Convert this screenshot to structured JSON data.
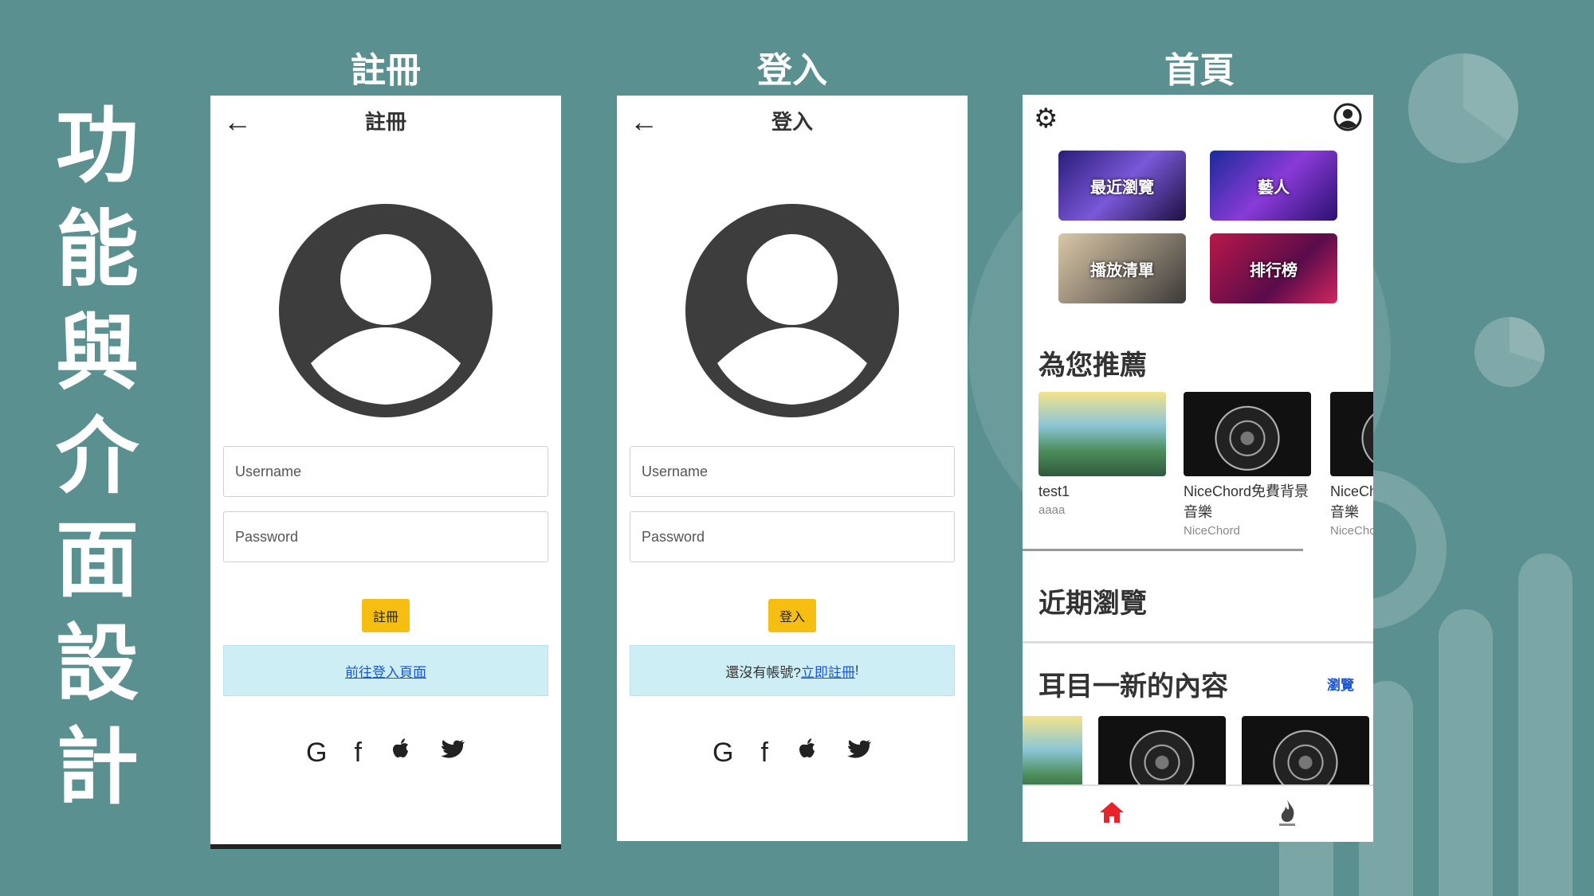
{
  "side_title": [
    "功",
    "能",
    "與",
    "介",
    "面",
    "設",
    "計"
  ],
  "panels": {
    "register": {
      "title": "註冊",
      "header": "註冊",
      "username_placeholder": "Username",
      "password_placeholder": "Password",
      "button": "註冊",
      "link": "前往登入頁面"
    },
    "login": {
      "title": "登入",
      "header": "登入",
      "username_placeholder": "Username",
      "password_placeholder": "Password",
      "button": "登入",
      "prompt": "還沒有帳號? ",
      "link": "立即註冊",
      "suffix": "!"
    },
    "home": {
      "title": "首頁",
      "categories": [
        "最近瀏覽",
        "藝人",
        "播放清單",
        "排行榜"
      ],
      "recommend_title": "為您推薦",
      "recommendations": [
        {
          "title": "test1",
          "subtitle": "aaaa"
        },
        {
          "title": "NiceChord免費背景音樂",
          "subtitle": "NiceChord"
        },
        {
          "title": "NiceCh 音樂",
          "subtitle": "NiceCho"
        }
      ],
      "recent_title": "近期瀏覽",
      "new_title": "耳目一新的內容",
      "browse_link": "瀏覽"
    }
  },
  "icons": {
    "back": "←",
    "social": [
      "G",
      "f",
      "",
      "🐦"
    ],
    "gear": "⚙",
    "account": "◉",
    "home": "⌂",
    "fire": "🔥"
  },
  "colors": {
    "background": "#5b9090",
    "accent_button": "#f5be10",
    "info_box": "#cdeef5",
    "home_icon": "#e8242a"
  }
}
